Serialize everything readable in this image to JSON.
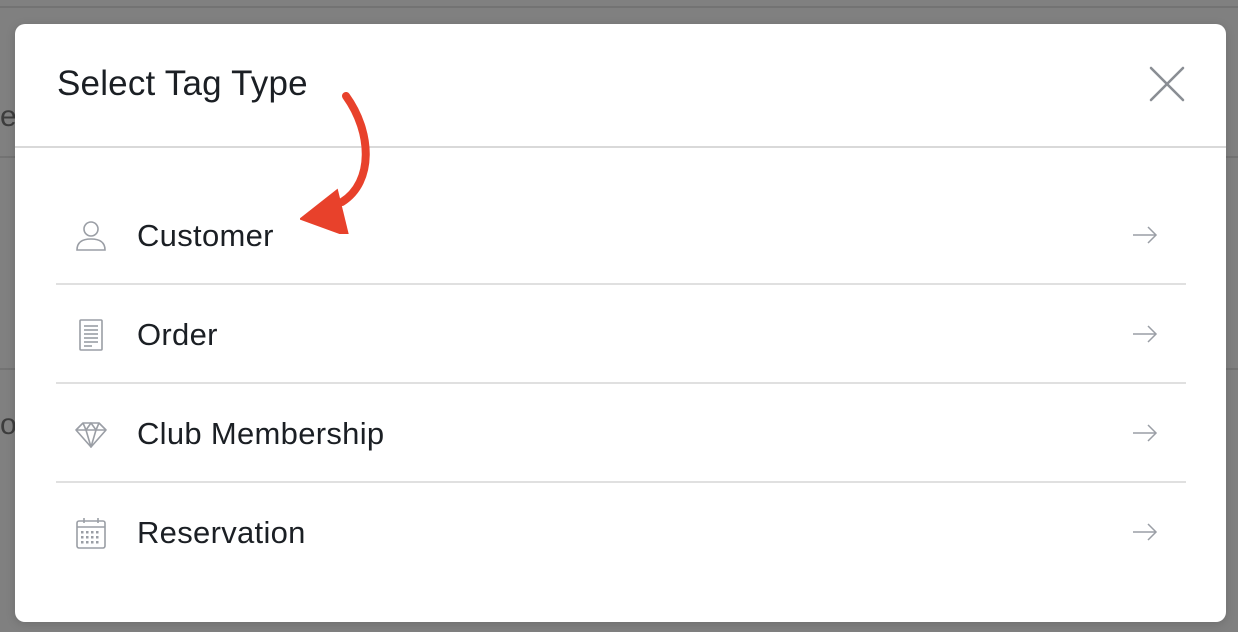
{
  "modal": {
    "title": "Select Tag Type",
    "close_icon": "close-icon",
    "items": [
      {
        "label": "Customer",
        "icon": "person-icon",
        "arrow": "arrow-right-icon"
      },
      {
        "label": "Order",
        "icon": "document-icon",
        "arrow": "arrow-right-icon"
      },
      {
        "label": "Club Membership",
        "icon": "diamond-icon",
        "arrow": "arrow-right-icon"
      },
      {
        "label": "Reservation",
        "icon": "calendar-icon",
        "arrow": "arrow-right-icon"
      }
    ]
  },
  "background": {
    "fragment_1": "e",
    "fragment_2": "ol"
  },
  "colors": {
    "overlay": "#808080",
    "modal_bg": "#ffffff",
    "text": "#1b1f24",
    "icon": "#9a9ea5",
    "divider": "#e0e0e0",
    "annotation": "#e8412b"
  }
}
